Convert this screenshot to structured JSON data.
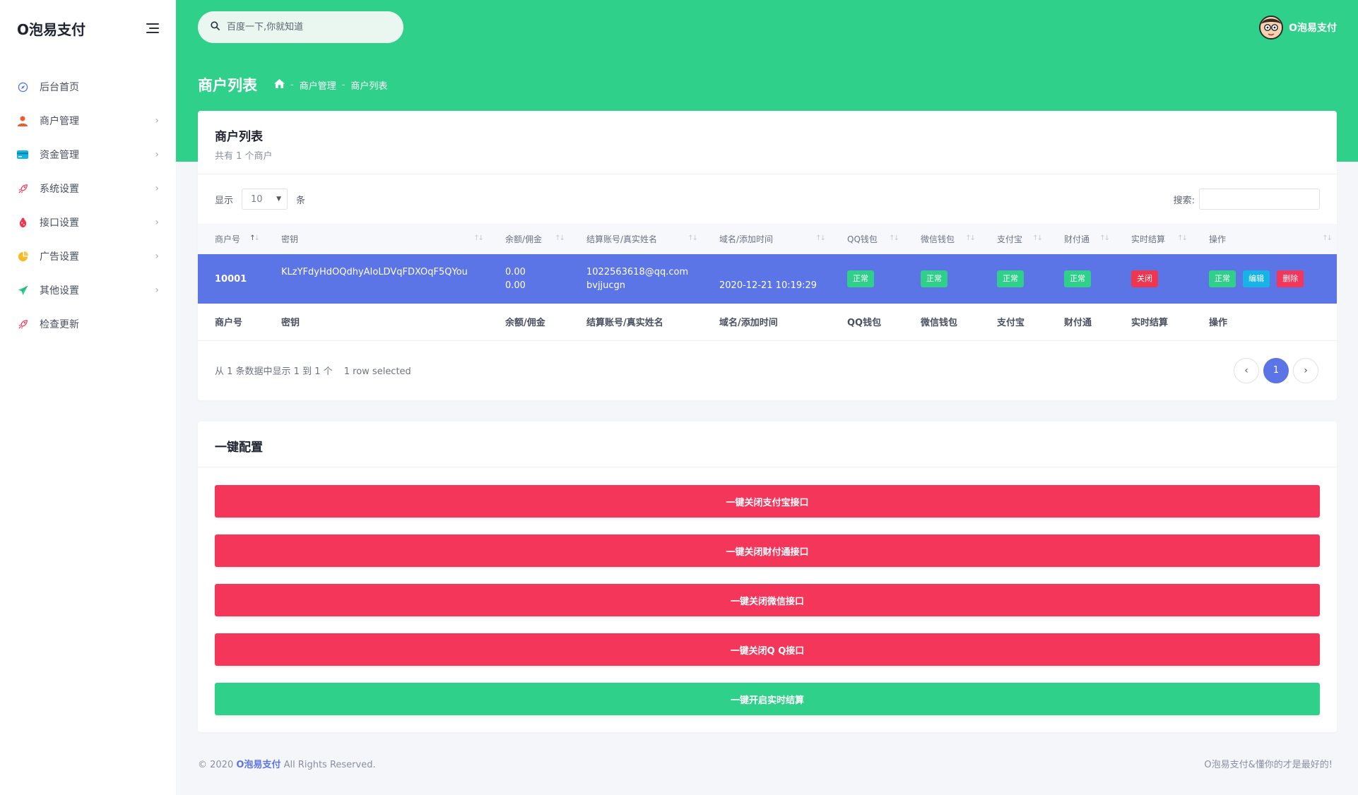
{
  "brand": {
    "name": "O泡易支付"
  },
  "sidebar": {
    "items": [
      {
        "label": "后台首页",
        "icon": "compass-icon",
        "color": "#5b74e6",
        "has_children": false
      },
      {
        "label": "商户管理",
        "icon": "user-icon",
        "color": "#f05b2d",
        "has_children": true
      },
      {
        "label": "资金管理",
        "icon": "card-icon",
        "color": "#16b4e6",
        "has_children": true
      },
      {
        "label": "系统设置",
        "icon": "rocket-icon",
        "color": "#f4365a",
        "has_children": true
      },
      {
        "label": "接口设置",
        "icon": "bug-icon",
        "color": "#f0364e",
        "has_children": true
      },
      {
        "label": "广告设置",
        "icon": "pie-chart-icon",
        "color": "#f7b924",
        "has_children": true
      },
      {
        "label": "其他设置",
        "icon": "send-icon",
        "color": "#2fd08a",
        "has_children": true
      },
      {
        "label": "检查更新",
        "icon": "rocket-icon",
        "color": "#f4365a",
        "has_children": false
      }
    ]
  },
  "header": {
    "search_placeholder": "百度一下,你就知道",
    "user_name": "O泡易支付"
  },
  "page": {
    "title": "商户列表",
    "breadcrumb": [
      "商户管理",
      "商户列表"
    ]
  },
  "merchant_card": {
    "title": "商户列表",
    "subtitle": "共有 1 个商户",
    "length_prefix": "显示",
    "length_value": "10",
    "length_suffix": "条",
    "search_label": "搜索:",
    "columns": [
      "商户号",
      "密钥",
      "余额/佣金",
      "结算账号/真实姓名",
      "域名/添加时间",
      "QQ钱包",
      "微信钱包",
      "支付宝",
      "财付通",
      "实时结算",
      "操作"
    ],
    "rows": [
      {
        "id": "10001",
        "key": "KLzYFdyHdOQdhyAIoLDVqFDXOqF5QYou",
        "balance": "0.00",
        "commission": "0.00",
        "account": "1022563618@qq.com",
        "real_name": "bvjjucgn",
        "domain": "",
        "added": "2020-12-21 10:19:29",
        "qq": "正常",
        "wechat": "正常",
        "alipay": "正常",
        "tenpay": "正常",
        "realtime": "关闭",
        "actions": [
          "正常",
          "编辑",
          "删除"
        ]
      }
    ],
    "info": "从 1 条数据中显示 1 到 1 个",
    "selected_info": "1 row selected",
    "pagination": {
      "prev": "‹",
      "current": "1",
      "next": "›"
    }
  },
  "config_card": {
    "title": "一键配置",
    "buttons": [
      {
        "label": "一键关闭支付宝接口",
        "style": "red"
      },
      {
        "label": "一键关闭财付通接口",
        "style": "red"
      },
      {
        "label": "一键关闭微信接口",
        "style": "red"
      },
      {
        "label": "一键关闭Q Q接口",
        "style": "red"
      },
      {
        "label": "一键开启实时结算",
        "style": "green"
      }
    ]
  },
  "footer": {
    "copyright_prefix": "© 2020",
    "brand_link": "O泡易支付",
    "copyright_suffix": "All Rights Reserved.",
    "slogan": "O泡易支付&懂你的才是最好的!"
  },
  "colors": {
    "accent": "#2fd08a",
    "primary": "#5b74e6",
    "danger": "#f4365a",
    "info": "#16b4e6"
  }
}
